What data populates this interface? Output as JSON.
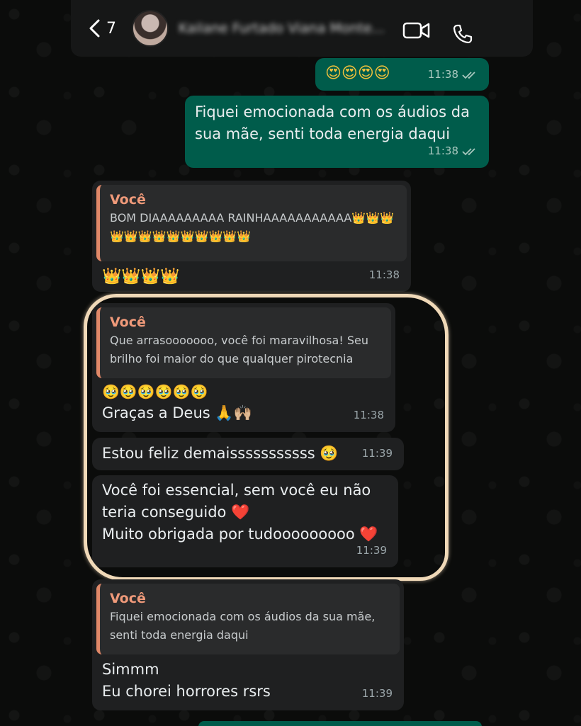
{
  "header": {
    "back_count": "7",
    "contact_name": "Kailane Furtado Viana Monte..."
  },
  "messages": {
    "m1": {
      "text": "😍😍😍😍",
      "time": "11:38"
    },
    "m2": {
      "text": "Fiquei emocionada com os áudios da sua mãe, senti toda energia daqui",
      "time": "11:38"
    },
    "m3": {
      "quote_author": "Você",
      "quote_text": "BOM DIAAAAAAAAA RAINHAAAAAAAAAAA👑👑👑👑👑👑👑👑👑👑👑👑👑",
      "text": "👑👑👑👑",
      "time": "11:38"
    },
    "m4": {
      "quote_author": "Você",
      "quote_text": "Que arrasooooooo, você foi maravilhosa! Seu brilho foi maior do que qualquer pirotecnia",
      "text_line1": "🥹🥹🥹🥹🥹🥹",
      "text_line2": "Graças a Deus 🙏🙌🏼",
      "time": "11:38"
    },
    "m5": {
      "text": "Estou feliz demaisssssssssss 🥹",
      "time": "11:39"
    },
    "m6": {
      "text_line1": "Você foi essencial, sem você eu não",
      "text_line2": "teria conseguido ❤️",
      "text_line3": "Muito obrigada por tudooooooooo ❤️",
      "time": "11:39"
    },
    "m7": {
      "quote_author": "Você",
      "quote_text": "Fiquei emocionada com os áudios da sua mãe, senti toda energia daqui",
      "text_line1": "Simmm",
      "text_line2": "Eu chorei horrores rsrs",
      "time": "11:39"
    }
  }
}
